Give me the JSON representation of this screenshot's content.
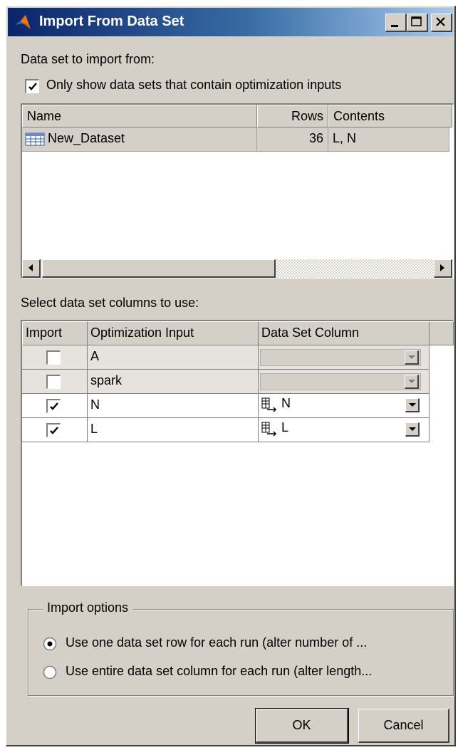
{
  "window": {
    "title": "Import From Data Set",
    "controls": {
      "minimize": "minimize",
      "maximize": "maximize",
      "close": "close"
    }
  },
  "datasets_section": {
    "label": "Data set to import from:",
    "filter_checkbox": {
      "label": "Only show data sets that contain optimization inputs",
      "checked": true
    },
    "table": {
      "columns": [
        "Name",
        "Rows",
        "Contents"
      ],
      "rows": [
        {
          "name": "New_Dataset",
          "rows": "36",
          "contents": "L, N"
        }
      ]
    }
  },
  "columns_section": {
    "label": "Select data set columns to use:",
    "table": {
      "columns": [
        "Import",
        "Optimization Input",
        "Data Set Column"
      ],
      "rows": [
        {
          "import": false,
          "input": "A",
          "column": ""
        },
        {
          "import": false,
          "input": "spark",
          "column": ""
        },
        {
          "import": true,
          "input": "N",
          "column": "N"
        },
        {
          "import": true,
          "input": "L",
          "column": "L"
        }
      ]
    }
  },
  "import_options": {
    "legend": "Import options",
    "option1": {
      "label": "Use one data set row for each run (alter number of ...",
      "selected": true
    },
    "option2": {
      "label": "Use entire data set column for each run (alter length...",
      "selected": false
    }
  },
  "buttons": {
    "ok": "OK",
    "cancel": "Cancel"
  },
  "colors": {
    "titlebar_start": "#0a246a",
    "titlebar_end": "#a6caf0",
    "dialog_bg": "#d4d0c8"
  }
}
